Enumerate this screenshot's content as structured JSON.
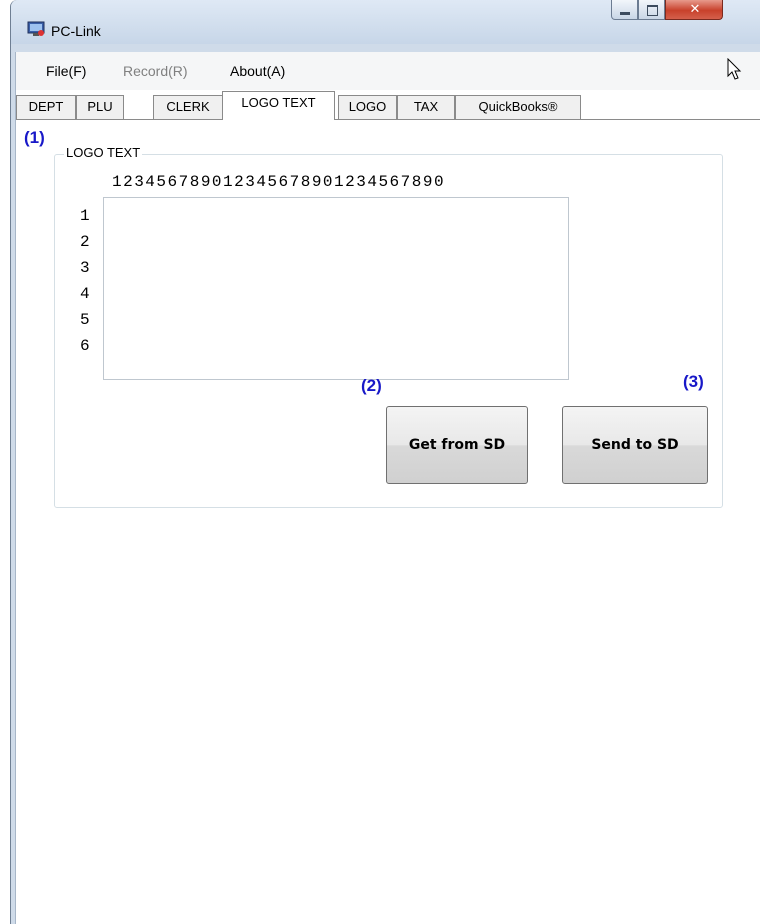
{
  "window": {
    "title": "PC-Link"
  },
  "menu": [
    {
      "label": "File(F)",
      "enabled": true
    },
    {
      "label": "Record(R)",
      "enabled": false
    },
    {
      "label": "About(A)",
      "enabled": true
    }
  ],
  "tabs": [
    {
      "label": "DEPT"
    },
    {
      "label": "PLU"
    },
    {
      "label": "CLERK"
    },
    {
      "label": "LOGO TEXT",
      "active": true
    },
    {
      "label": "LOGO"
    },
    {
      "label": "TAX"
    },
    {
      "label": "QuickBooks®"
    }
  ],
  "logo_text": {
    "group_label": "LOGO TEXT",
    "ruler": "123456789012345678901234567890",
    "line_numbers": [
      "1",
      "2",
      "3",
      "4",
      "5",
      "6"
    ],
    "text_value": ""
  },
  "buttons": {
    "get_label": "Get from SD",
    "send_label": "Send to SD"
  },
  "annotations": {
    "a1": "(1)",
    "a2": "(2)",
    "a3": "(3)"
  },
  "colors": {
    "annotation": "#1818c8",
    "close_button": "#c8412b"
  }
}
